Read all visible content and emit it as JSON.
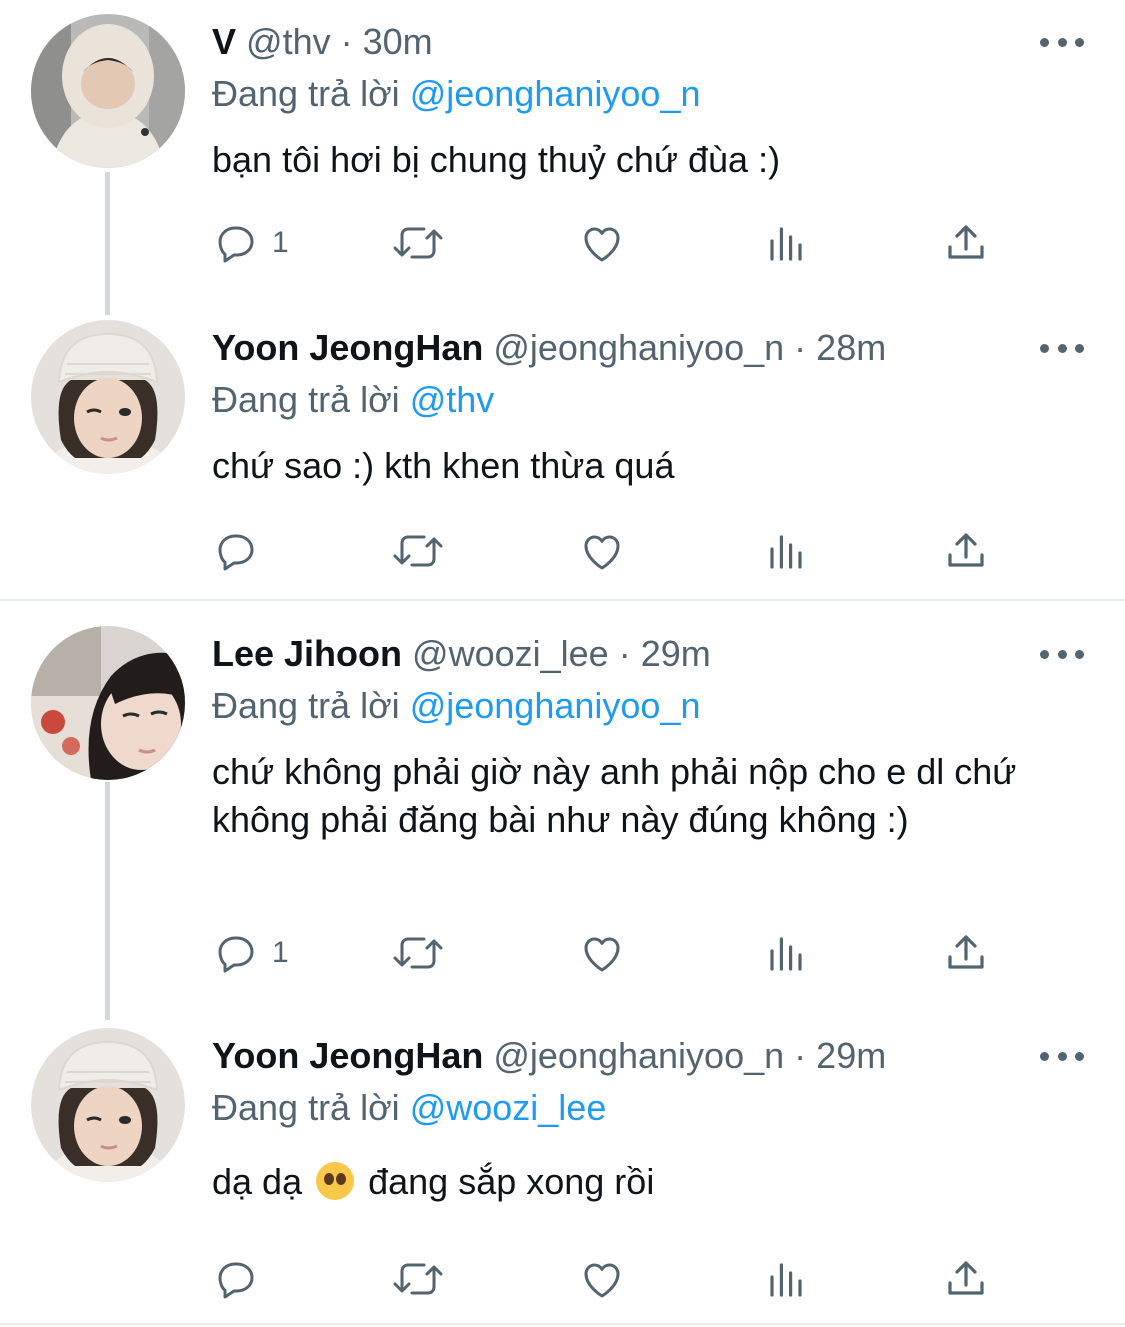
{
  "tweets": [
    {
      "name": "V",
      "handle": "@thv",
      "time": "30m",
      "replying_label": "Đang trả lời",
      "replying_to": "@jeonghaniyoo_n",
      "text": "bạn tôi hơi bị chung thuỷ chứ đùa :)",
      "reply_count": "1"
    },
    {
      "name": "Yoon JeongHan",
      "handle": "@jeonghaniyoo_n",
      "time": "28m",
      "replying_label": "Đang trả lời",
      "replying_to": "@thv",
      "text": "chứ sao :) kth khen thừa quá",
      "reply_count": ""
    },
    {
      "name": "Lee Jihoon",
      "handle": "@woozi_lee",
      "time": "29m",
      "replying_label": "Đang trả lời",
      "replying_to": "@jeonghaniyoo_n",
      "text": "chứ không phải giờ này anh phải nộp cho e dl chứ không phải đăng bài như này đúng không :)",
      "reply_count": "1"
    },
    {
      "name": "Yoon JeongHan",
      "handle": "@jeonghaniyoo_n",
      "time": "29m",
      "replying_label": "Đang trả lời",
      "replying_to": "@woozi_lee",
      "text_before": "dạ dạ",
      "emoji": "pleading-face-emoji",
      "text_after": " đang sắp xong rồi",
      "reply_count": ""
    }
  ],
  "separator": "·",
  "colors": {
    "accent": "#1d9bf0",
    "secondary": "#536471",
    "text": "#0f1419",
    "thread_line": "#cfd9de"
  },
  "icons": [
    "reply-icon",
    "retweet-icon",
    "like-icon",
    "analytics-icon",
    "share-icon",
    "more-icon"
  ]
}
